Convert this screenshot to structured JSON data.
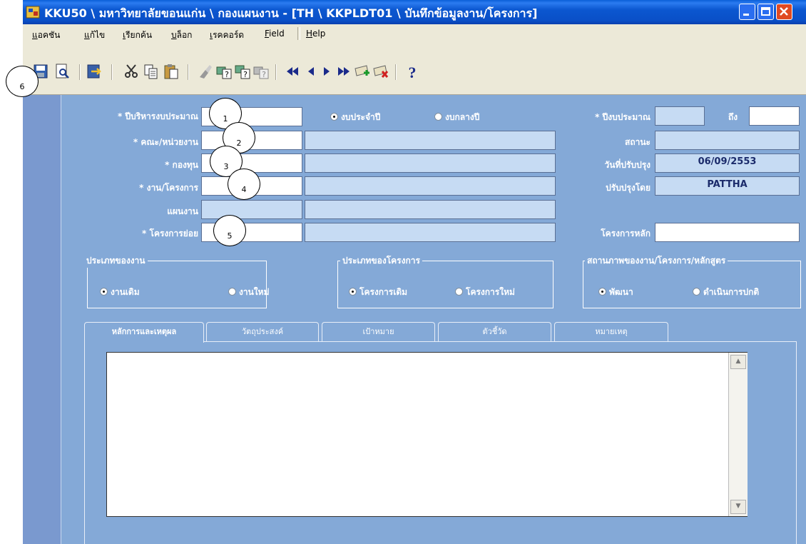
{
  "title": "KKU50 \\ มหาวิทยาลัยขอนแก่น \\ กองแผนงาน - [TH \\ KKPLDT01 \\ บันทึกข้อมูลงาน/โครงการ]",
  "menu": [
    "แอคชัน",
    "แก้ไข",
    "เรียกค้น",
    "บล็อก",
    "เรคคอร์ด",
    "Field",
    "Help"
  ],
  "toolbar_icons": [
    "save-icon",
    "print-preview-icon",
    "exit-icon",
    "cut-icon",
    "copy-icon",
    "paste-icon",
    "clear-icon",
    "enter-query-icon",
    "execute-query-icon",
    "cancel-query-icon",
    "first-record-icon",
    "previous-record-icon",
    "next-record-icon",
    "last-record-icon",
    "insert-record-icon",
    "delete-record-icon",
    "help-icon"
  ],
  "form": {
    "budget_admin_year_label": "* ปีบริหารงบประมาณ",
    "faculty_label": "* คณะ/หน่วยงาน",
    "fund_label": "* กองทุน",
    "project_label": "* งาน/โครงการ",
    "plan_label": "แผนงาน",
    "subproject_label": "* โครงการย่อย",
    "radio_annual": "งบประจำปี",
    "radio_central": "งบกลางปี",
    "budget_year_label": "* ปีงบประมาณ",
    "to_label": "ถึง",
    "status_label": "สถานะ",
    "update_date_label": "วันที่ปรับปรุง",
    "update_date_value": "06/09/2553",
    "updated_by_label": "ปรับปรุงโดย",
    "updated_by_value": "PATTHA",
    "main_project_label": "โครงการหลัก"
  },
  "groups": {
    "work_type": {
      "title": "ประเภทของงาน",
      "opt1": "งานเดิม",
      "opt2": "งานใหม่"
    },
    "project_type": {
      "title": "ประเภทของโครงการ",
      "opt1": "โครงการเดิม",
      "opt2": "โครงการใหม่"
    },
    "status": {
      "title": "สถานภาพของงาน/โครงการ/หลักสูตร",
      "opt1": "พัฒนา",
      "opt2": "ดำเนินการปกติ"
    }
  },
  "tabs": [
    "หลักการและเหตุผล",
    "วัตถุประสงค์",
    "เป้าหมาย",
    "ตัวชี้วัด",
    "หมายเหตุ"
  ],
  "callouts": [
    "1",
    "2",
    "3",
    "4",
    "5",
    "6"
  ]
}
